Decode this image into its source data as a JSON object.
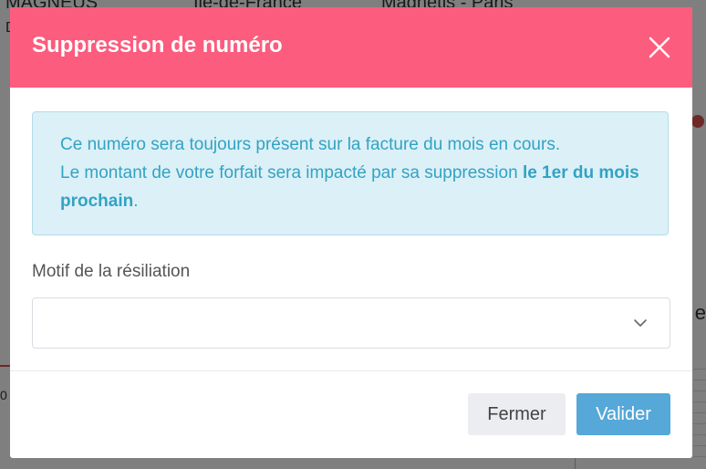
{
  "background": {
    "top_texts": [
      "MAGNEUS",
      "Ile-de-France",
      "Magnetis - Paris"
    ],
    "side_letter_left_top": "D",
    "side_letter_right": "e",
    "side_text_left": "0"
  },
  "modal": {
    "title": "Suppression de numéro",
    "close_icon": "close-icon",
    "alert": {
      "line1": "Ce numéro sera toujours présent sur la facture du mois en cours.",
      "line2_prefix": "Le montant de votre forfait sera impacté par sa suppression ",
      "line2_bold": "le 1er du mois prochain",
      "line2_suffix": "."
    },
    "field": {
      "label": "Motif de la résiliation",
      "selected_value": "",
      "chevron_icon": "chevron-down-icon"
    },
    "buttons": {
      "close_label": "Fermer",
      "submit_label": "Valider"
    }
  },
  "colors": {
    "header": "#fc5c7d",
    "alert_bg": "#dcf0f7",
    "alert_text": "#31a3c4",
    "primary_button": "#55a8d8",
    "secondary_button": "#ebedf0"
  }
}
